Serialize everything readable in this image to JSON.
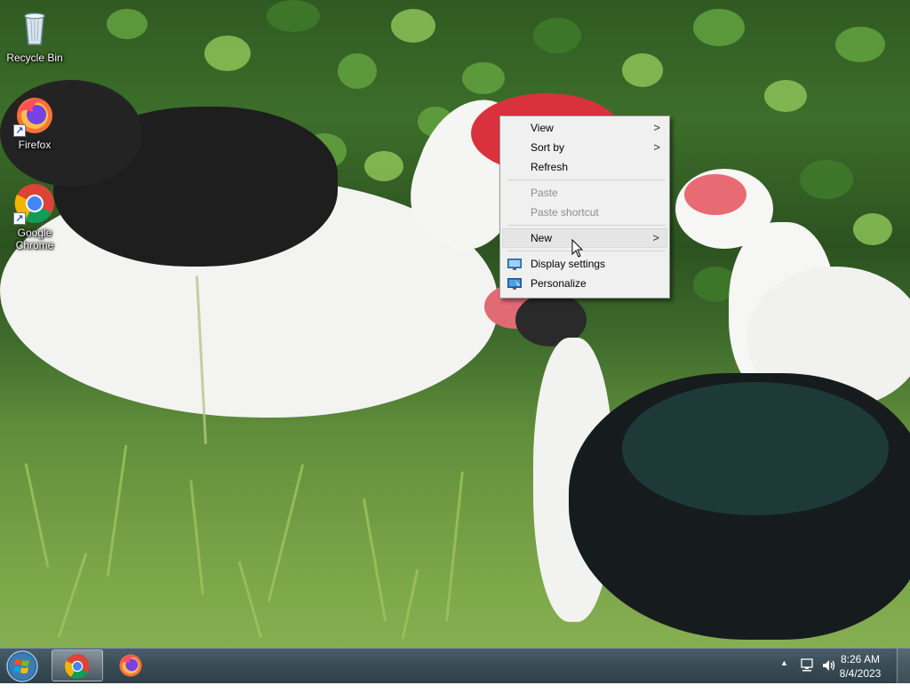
{
  "desktop": {
    "icons": [
      {
        "label": "Recycle Bin",
        "icon": "recycle-bin-icon"
      },
      {
        "label": "Firefox",
        "icon": "firefox-icon"
      },
      {
        "label": "Google Chrome",
        "icon": "chrome-icon"
      }
    ]
  },
  "context_menu": {
    "items": [
      {
        "label": "View",
        "has_submenu": true,
        "enabled": true
      },
      {
        "label": "Sort by",
        "has_submenu": true,
        "enabled": true
      },
      {
        "label": "Refresh",
        "has_submenu": false,
        "enabled": true
      },
      {
        "label": "Paste",
        "has_submenu": false,
        "enabled": false
      },
      {
        "label": "Paste shortcut",
        "has_submenu": false,
        "enabled": false
      },
      {
        "label": "New",
        "has_submenu": true,
        "enabled": true,
        "highlighted": true
      },
      {
        "label": "Display settings",
        "has_submenu": false,
        "enabled": true,
        "icon": "display-settings-icon"
      },
      {
        "label": "Personalize",
        "has_submenu": false,
        "enabled": true,
        "icon": "personalize-icon"
      }
    ],
    "submenu_glyph": ">"
  },
  "taskbar": {
    "start_icon": "windows-start-icon",
    "pinned": [
      {
        "name": "Google Chrome",
        "icon": "chrome-icon",
        "active": true
      },
      {
        "name": "Firefox",
        "icon": "firefox-icon",
        "active": false
      }
    ],
    "tray": {
      "show_hidden_glyph": "▲",
      "icons": [
        "network-icon",
        "volume-icon"
      ]
    },
    "clock": {
      "time": "8:26 AM",
      "date": "8/4/2023"
    }
  }
}
